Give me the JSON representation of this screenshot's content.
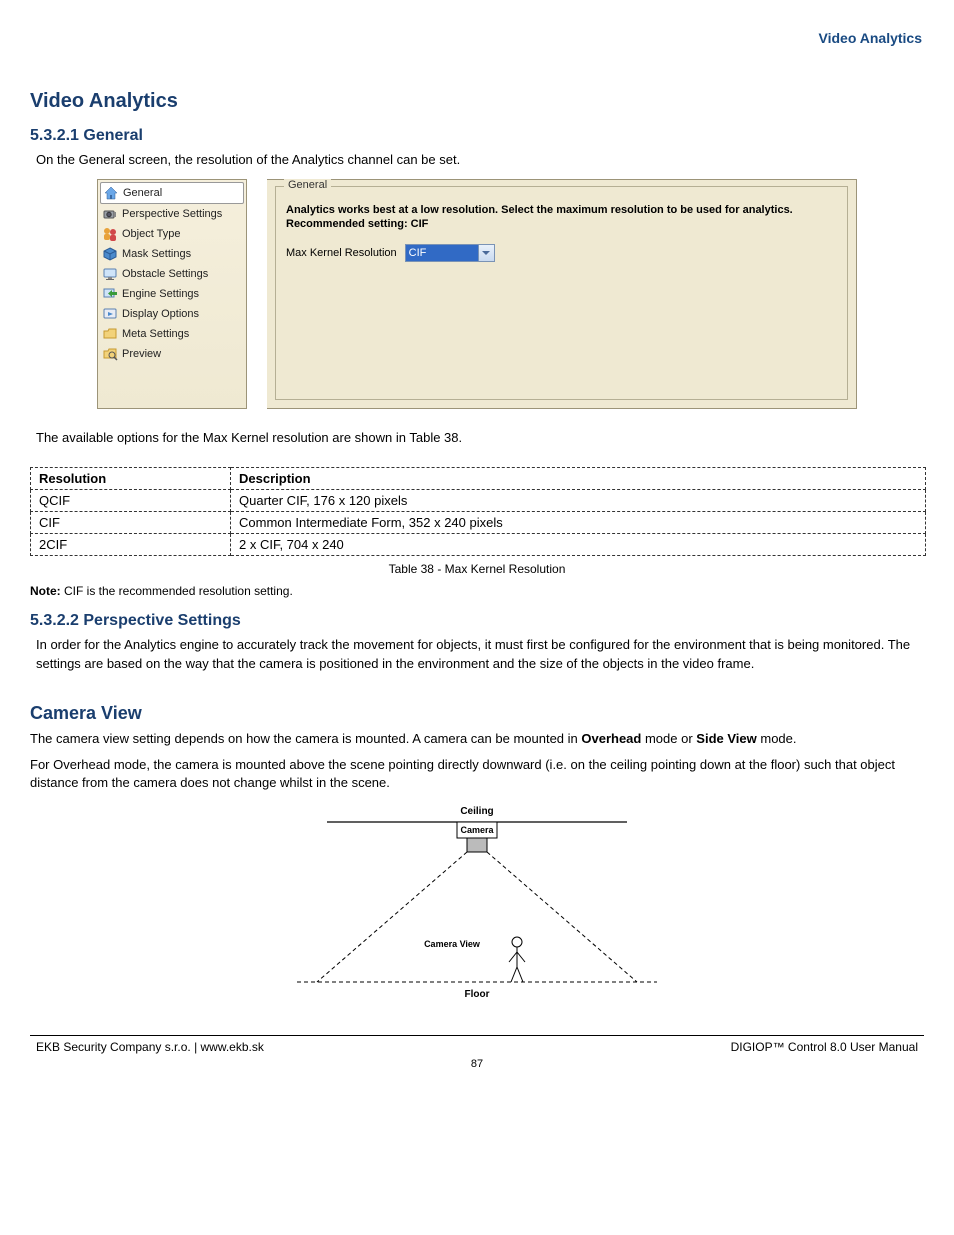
{
  "header_page_title": "Video Analytics",
  "doc_title": "Video Analytics",
  "s1_num": "5.3.2.1 General",
  "s1_p1": "On the General screen, the resolution of the Analytics channel can be set.",
  "sidebar": {
    "items": [
      {
        "label": "General"
      },
      {
        "label": "Perspective Settings"
      },
      {
        "label": "Object Type"
      },
      {
        "label": "Mask Settings"
      },
      {
        "label": "Obstacle Settings"
      },
      {
        "label": "Engine Settings"
      },
      {
        "label": "Display Options"
      },
      {
        "label": "Meta Settings"
      },
      {
        "label": "Preview"
      }
    ]
  },
  "panel": {
    "legend": "General",
    "description": "Analytics works best at a low resolution.  Select the maximum resolution to be used for analytics.  Recommended setting: CIF",
    "field_label": "Max Kernel Resolution",
    "field_value": "CIF"
  },
  "s1_after_img": "The available options for the Max Kernel resolution are shown in Table 38.",
  "table": {
    "header_left": "Resolution",
    "header_right": "Description",
    "rows": [
      {
        "l": "QCIF",
        "r": "Quarter CIF, 176 x 120 pixels"
      },
      {
        "l": "CIF",
        "r": "Common Intermediate Form, 352 x 240 pixels"
      },
      {
        "l": "2CIF",
        "r": "2 x CIF, 704 x 240"
      }
    ]
  },
  "table_caption": "Table 38 - Max Kernel Resolution",
  "table_note_label": "Note:",
  "table_note_text": " CIF is the recommended resolution setting.",
  "s2_num": "5.3.2.2 Perspective Settings",
  "s2_p1": "In order for the Analytics engine to accurately track the movement for objects, it must first be configured for the environment that is being monitored. The settings are based on the way that the camera is positioned in the environment and the size of the objects in the video frame.",
  "s2_h1": "Camera View",
  "s2_p2a": "The camera view setting depends on how the camera is mounted. A camera can be mounted in ",
  "s2_p2b": "Overhead",
  "s2_p2c": " mode or ",
  "s2_p2d": "Side View",
  "s2_p2e": " mode.",
  "s2_p3": "For Overhead mode, the camera is mounted above the scene pointing directly downward (i.e. on the ceiling pointing down at the floor) such that object distance from the camera does not change whilst in the scene.",
  "diagram": {
    "ceiling": "Ceiling",
    "camera": "Camera",
    "camera_view": "Camera View",
    "floor": "Floor"
  },
  "footer": {
    "left": "EKB Security Company s.r.o. | www.ekb.sk",
    "right": "DIGIOP™ Control 8.0 User Manual",
    "page": "87"
  }
}
